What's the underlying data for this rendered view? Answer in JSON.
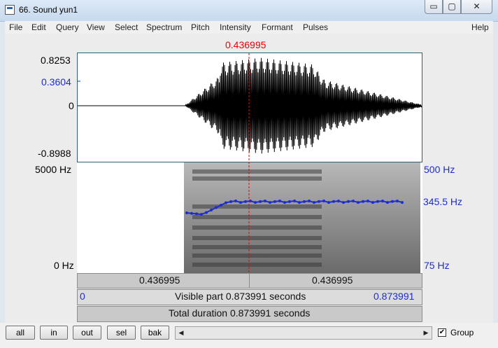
{
  "window": {
    "title": "66. Sound yun1",
    "minimize": "▭",
    "maximize": "▢",
    "close": "✕"
  },
  "menu": [
    "File",
    "Edit",
    "Query",
    "View",
    "Select",
    "Spectrum",
    "Pitch",
    "Intensity",
    "Formant",
    "Pulses",
    "Help"
  ],
  "cursor_time": "0.436995",
  "waveform": {
    "max": "0.8253",
    "cursor_value": "0.3604",
    "zero": "0",
    "min": "-0.8988"
  },
  "spectrogram": {
    "top_freq": "5000 Hz",
    "bottom_freq": "0 Hz",
    "pitch_top": "500 Hz",
    "pitch_value": "345.5 Hz",
    "pitch_bottom": "75 Hz"
  },
  "bars": {
    "left_segment": "0.436995",
    "right_segment": "0.436995",
    "visible_start": "0",
    "visible_part": "Visible part 0.873991 seconds",
    "visible_end": "0.873991",
    "total_duration": "Total duration 0.873991 seconds"
  },
  "buttons": {
    "all": "all",
    "in": "in",
    "out": "out",
    "sel": "sel",
    "bak": "bak"
  },
  "group": {
    "label": "Group",
    "checked": true
  },
  "colors": {
    "pitch": "#1d2cd0",
    "cursor": "#e00000",
    "waveform": "#000000"
  }
}
